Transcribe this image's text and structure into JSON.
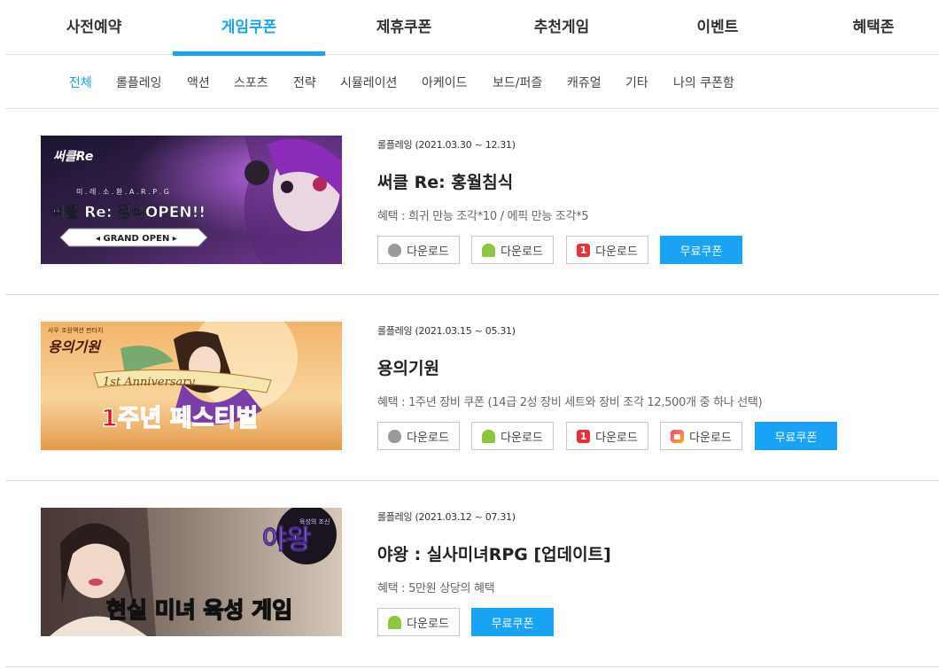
{
  "top_tabs": [
    {
      "label": "사전예약",
      "active": false
    },
    {
      "label": "게임쿠폰",
      "active": true
    },
    {
      "label": "제휴쿠폰",
      "active": false
    },
    {
      "label": "추천게임",
      "active": false
    },
    {
      "label": "이벤트",
      "active": false
    },
    {
      "label": "혜택존",
      "active": false
    }
  ],
  "sub_tabs": [
    {
      "label": "전체",
      "active": true
    },
    {
      "label": "롤플레잉"
    },
    {
      "label": "액션"
    },
    {
      "label": "스포츠"
    },
    {
      "label": "전략"
    },
    {
      "label": "시뮬레이션"
    },
    {
      "label": "아케이드"
    },
    {
      "label": "보드/퍼즐"
    },
    {
      "label": "캐쥬얼"
    },
    {
      "label": "기타"
    },
    {
      "label": "나의 쿠폰함"
    }
  ],
  "games": [
    {
      "meta": "롤플레잉 (2021.03.30 ~ 12.31)",
      "title": "써클 Re: 홍월침식",
      "benefit": "혜택 : 희귀 만능 조각*10 / 에픽 만능 조각*5",
      "banner": {
        "logo": "써클Re",
        "sub": "미 . 레 . 소 . 환 . A . R . P . G",
        "headline": "써클 Re: 정식OPEN!!",
        "tag": "◂ GRAND OPEN ▸"
      },
      "buttons": [
        {
          "icon": "apple-icon",
          "label": "다운로드"
        },
        {
          "icon": "android-icon",
          "label": "다운로드"
        },
        {
          "icon": "onestore-icon",
          "label": "다운로드"
        },
        {
          "icon": "",
          "label": "무료쿠폰",
          "coupon": true
        }
      ]
    },
    {
      "meta": "롤플레잉 (2021.03.15 ~ 05.31)",
      "title": "용의기원",
      "benefit": "혜택 : 1주년 장비 쿠폰 (14급 2성 장비 세트와 장비 조각 12,500개 중 하나 선택)",
      "banner": {
        "logo": "용의기원",
        "sub": "사우 조원액션 판타지",
        "headline": "1주년 페스티벌",
        "tag": "1st Anniversary"
      },
      "buttons": [
        {
          "icon": "apple-icon",
          "label": "다운로드"
        },
        {
          "icon": "android-icon",
          "label": "다운로드"
        },
        {
          "icon": "onestore-icon",
          "label": "다운로드"
        },
        {
          "icon": "galaxy-store-icon",
          "label": "다운로드"
        },
        {
          "icon": "",
          "label": "무료쿠폰",
          "coupon": true
        }
      ]
    },
    {
      "meta": "롤플레잉 (2021.03.12 ~ 07.31)",
      "title": "야왕 : 실사미녀RPG [업데이트]",
      "benefit": "혜택 : 5만원 상당의 혜택",
      "banner": {
        "logo": "야왕",
        "sub": "육성의 조신",
        "headline": "현실 미녀 육성 게임"
      },
      "buttons": [
        {
          "icon": "android-icon",
          "label": "다운로드"
        },
        {
          "icon": "",
          "label": "무료쿠폰",
          "coupon": true
        }
      ]
    }
  ],
  "colors": {
    "accent": "#1aa3f5",
    "divider": "#dddddd"
  }
}
